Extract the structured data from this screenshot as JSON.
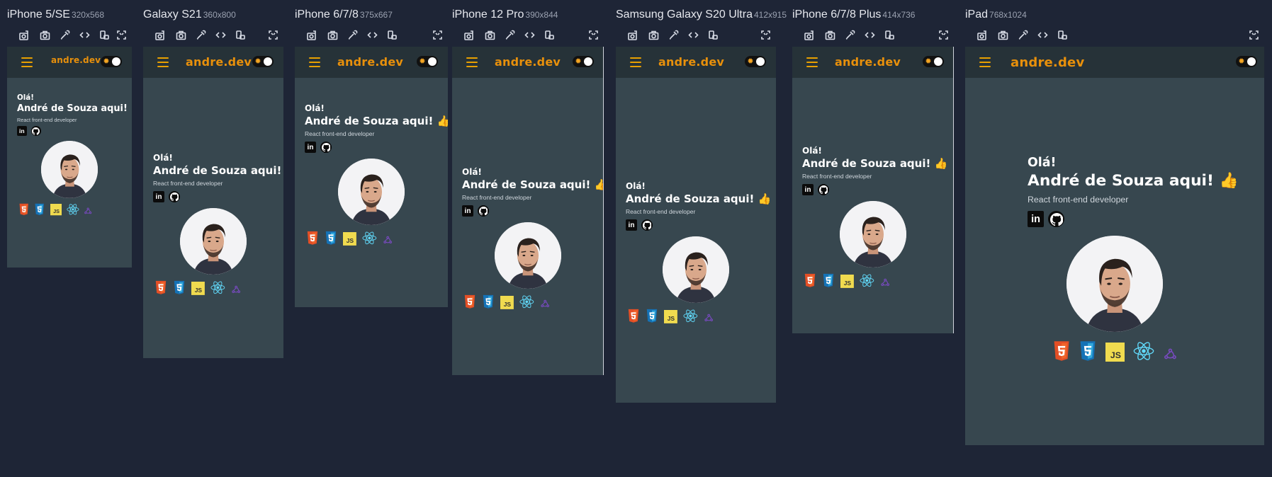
{
  "devices": [
    {
      "name": "iPhone 5/SE",
      "size": "320x568"
    },
    {
      "name": "Galaxy S21",
      "size": "360x800"
    },
    {
      "name": "iPhone 6/7/8",
      "size": "375x667"
    },
    {
      "name": "iPhone 12 Pro",
      "size": "390x844"
    },
    {
      "name": "Samsung Galaxy S20 Ultra",
      "size": "412x915"
    },
    {
      "name": "iPhone 6/7/8 Plus",
      "size": "414x736"
    },
    {
      "name": "iPad",
      "size": "768x1024"
    }
  ],
  "toolbar_icons": [
    "capture-icon",
    "camera-icon",
    "eyedropper-icon",
    "code-icon",
    "rotate-icon",
    "fullscreen-icon"
  ],
  "site": {
    "brand": "andre.dev",
    "greeting": "Olá!",
    "name": "André de Souza aqui! 👍",
    "role": "React front-end developer"
  },
  "colors": {
    "page_bg": "#1e2536",
    "site_bg": "#37474f",
    "header_bg": "#263238",
    "brand": "#e8900b"
  }
}
